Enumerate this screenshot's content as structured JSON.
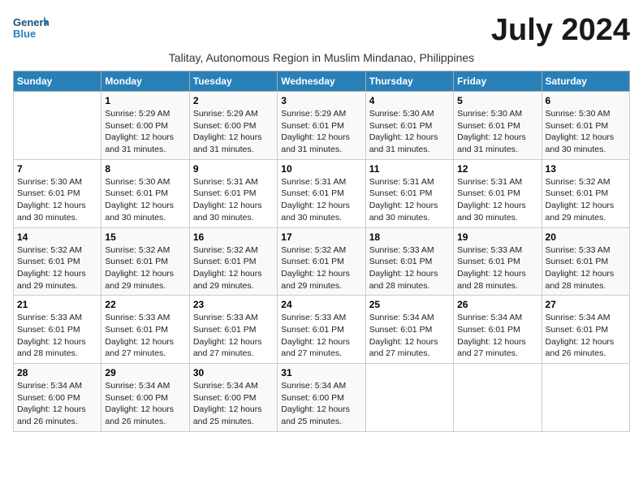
{
  "logo": {
    "general": "General",
    "blue": "Blue"
  },
  "title": "July 2024",
  "subtitle": "Talitay, Autonomous Region in Muslim Mindanao, Philippines",
  "days_of_week": [
    "Sunday",
    "Monday",
    "Tuesday",
    "Wednesday",
    "Thursday",
    "Friday",
    "Saturday"
  ],
  "weeks": [
    [
      {
        "day": "",
        "info": ""
      },
      {
        "day": "1",
        "info": "Sunrise: 5:29 AM\nSunset: 6:00 PM\nDaylight: 12 hours and 31 minutes."
      },
      {
        "day": "2",
        "info": "Sunrise: 5:29 AM\nSunset: 6:00 PM\nDaylight: 12 hours and 31 minutes."
      },
      {
        "day": "3",
        "info": "Sunrise: 5:29 AM\nSunset: 6:01 PM\nDaylight: 12 hours and 31 minutes."
      },
      {
        "day": "4",
        "info": "Sunrise: 5:30 AM\nSunset: 6:01 PM\nDaylight: 12 hours and 31 minutes."
      },
      {
        "day": "5",
        "info": "Sunrise: 5:30 AM\nSunset: 6:01 PM\nDaylight: 12 hours and 31 minutes."
      },
      {
        "day": "6",
        "info": "Sunrise: 5:30 AM\nSunset: 6:01 PM\nDaylight: 12 hours and 30 minutes."
      }
    ],
    [
      {
        "day": "7",
        "info": "Sunrise: 5:30 AM\nSunset: 6:01 PM\nDaylight: 12 hours and 30 minutes."
      },
      {
        "day": "8",
        "info": "Sunrise: 5:30 AM\nSunset: 6:01 PM\nDaylight: 12 hours and 30 minutes."
      },
      {
        "day": "9",
        "info": "Sunrise: 5:31 AM\nSunset: 6:01 PM\nDaylight: 12 hours and 30 minutes."
      },
      {
        "day": "10",
        "info": "Sunrise: 5:31 AM\nSunset: 6:01 PM\nDaylight: 12 hours and 30 minutes."
      },
      {
        "day": "11",
        "info": "Sunrise: 5:31 AM\nSunset: 6:01 PM\nDaylight: 12 hours and 30 minutes."
      },
      {
        "day": "12",
        "info": "Sunrise: 5:31 AM\nSunset: 6:01 PM\nDaylight: 12 hours and 30 minutes."
      },
      {
        "day": "13",
        "info": "Sunrise: 5:32 AM\nSunset: 6:01 PM\nDaylight: 12 hours and 29 minutes."
      }
    ],
    [
      {
        "day": "14",
        "info": "Sunrise: 5:32 AM\nSunset: 6:01 PM\nDaylight: 12 hours and 29 minutes."
      },
      {
        "day": "15",
        "info": "Sunrise: 5:32 AM\nSunset: 6:01 PM\nDaylight: 12 hours and 29 minutes."
      },
      {
        "day": "16",
        "info": "Sunrise: 5:32 AM\nSunset: 6:01 PM\nDaylight: 12 hours and 29 minutes."
      },
      {
        "day": "17",
        "info": "Sunrise: 5:32 AM\nSunset: 6:01 PM\nDaylight: 12 hours and 29 minutes."
      },
      {
        "day": "18",
        "info": "Sunrise: 5:33 AM\nSunset: 6:01 PM\nDaylight: 12 hours and 28 minutes."
      },
      {
        "day": "19",
        "info": "Sunrise: 5:33 AM\nSunset: 6:01 PM\nDaylight: 12 hours and 28 minutes."
      },
      {
        "day": "20",
        "info": "Sunrise: 5:33 AM\nSunset: 6:01 PM\nDaylight: 12 hours and 28 minutes."
      }
    ],
    [
      {
        "day": "21",
        "info": "Sunrise: 5:33 AM\nSunset: 6:01 PM\nDaylight: 12 hours and 28 minutes."
      },
      {
        "day": "22",
        "info": "Sunrise: 5:33 AM\nSunset: 6:01 PM\nDaylight: 12 hours and 27 minutes."
      },
      {
        "day": "23",
        "info": "Sunrise: 5:33 AM\nSunset: 6:01 PM\nDaylight: 12 hours and 27 minutes."
      },
      {
        "day": "24",
        "info": "Sunrise: 5:33 AM\nSunset: 6:01 PM\nDaylight: 12 hours and 27 minutes."
      },
      {
        "day": "25",
        "info": "Sunrise: 5:34 AM\nSunset: 6:01 PM\nDaylight: 12 hours and 27 minutes."
      },
      {
        "day": "26",
        "info": "Sunrise: 5:34 AM\nSunset: 6:01 PM\nDaylight: 12 hours and 27 minutes."
      },
      {
        "day": "27",
        "info": "Sunrise: 5:34 AM\nSunset: 6:01 PM\nDaylight: 12 hours and 26 minutes."
      }
    ],
    [
      {
        "day": "28",
        "info": "Sunrise: 5:34 AM\nSunset: 6:00 PM\nDaylight: 12 hours and 26 minutes."
      },
      {
        "day": "29",
        "info": "Sunrise: 5:34 AM\nSunset: 6:00 PM\nDaylight: 12 hours and 26 minutes."
      },
      {
        "day": "30",
        "info": "Sunrise: 5:34 AM\nSunset: 6:00 PM\nDaylight: 12 hours and 25 minutes."
      },
      {
        "day": "31",
        "info": "Sunrise: 5:34 AM\nSunset: 6:00 PM\nDaylight: 12 hours and 25 minutes."
      },
      {
        "day": "",
        "info": ""
      },
      {
        "day": "",
        "info": ""
      },
      {
        "day": "",
        "info": ""
      }
    ]
  ]
}
